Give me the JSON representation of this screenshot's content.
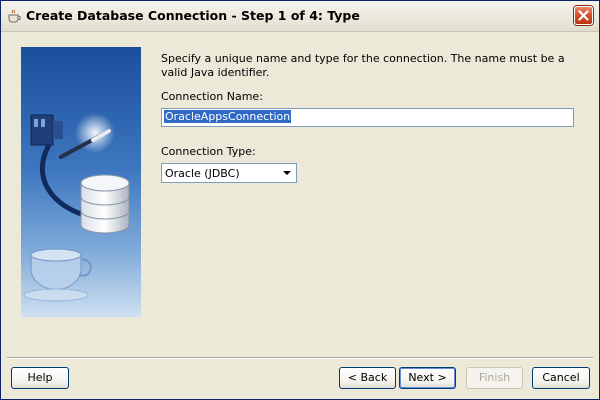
{
  "window": {
    "title": "Create Database Connection - Step 1 of 4: Type"
  },
  "form": {
    "instructions": "Specify a unique name and type for the connection. The name must be a valid Java identifier.",
    "connection_name_label": "Connection Name:",
    "connection_name_value": "OracleAppsConnection",
    "connection_type_label": "Connection Type:",
    "connection_type_value": "Oracle (JDBC)"
  },
  "buttons": {
    "help": "Help",
    "back": "< Back",
    "next": "Next >",
    "finish": "Finish",
    "cancel": "Cancel"
  },
  "colors": {
    "dialog_background": "#ece9d8",
    "selection": "#316ac5",
    "input_border": "#7f9db9",
    "close_button": "#cf4a22"
  },
  "icons": {
    "title": "coffee-cup-icon",
    "close": "close-icon",
    "dropdown": "chevron-down-icon",
    "illustration": "database-wizard-illustration"
  }
}
